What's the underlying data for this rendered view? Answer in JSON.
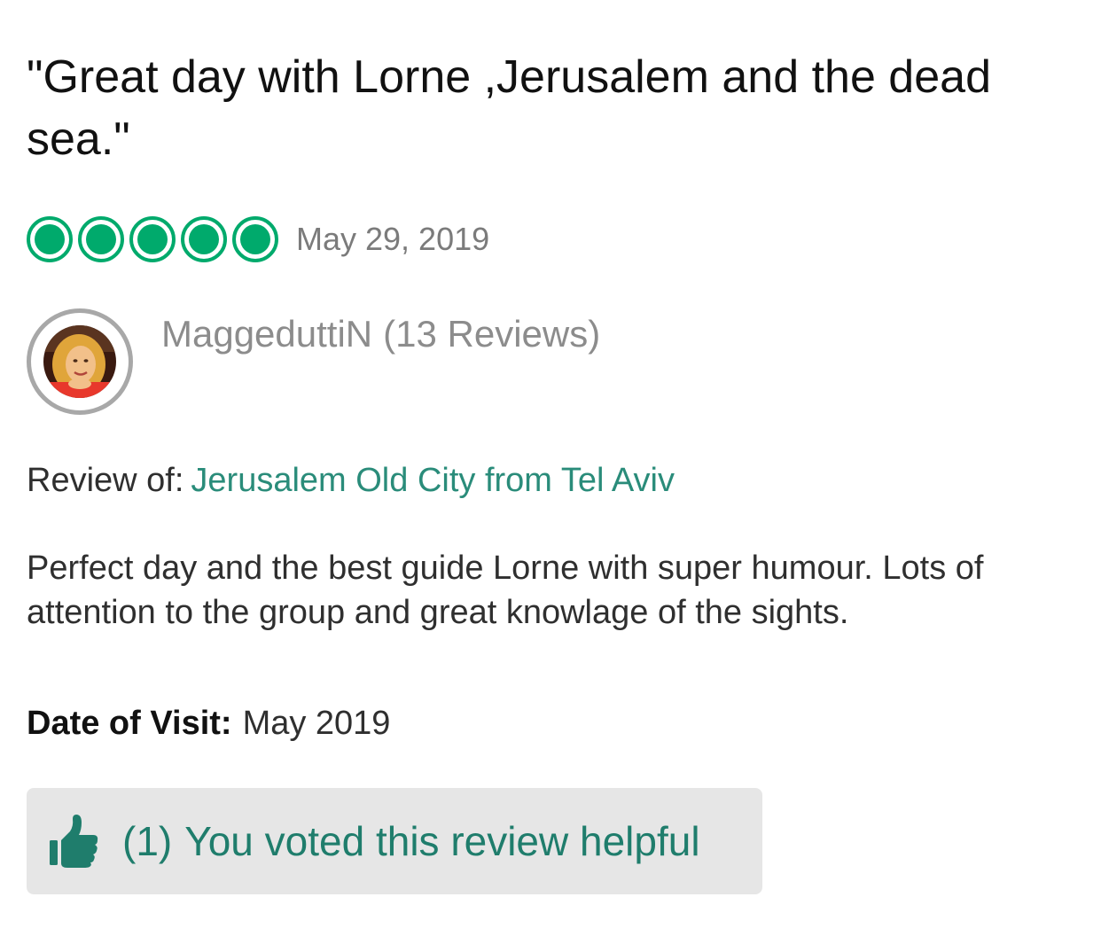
{
  "colors": {
    "accent": "#00aa6c",
    "link": "#2a8c7a",
    "helpful_text": "#1f7d6c"
  },
  "review": {
    "title": "\"Great day with Lorne ,Jerusalem and the dead sea.\"",
    "rating": 5,
    "rating_max": 5,
    "date": "May 29, 2019",
    "reviewer": {
      "name": "MaggeduttiN",
      "review_count": "(13 Reviews)"
    },
    "review_of_label": "Review of:",
    "review_of_link": "Jerusalem Old City from Tel Aviv",
    "body": "Perfect day and the best guide Lorne with super humour. Lots of attention to the group and great knowlage of the sights.",
    "date_of_visit_label": "Date of Visit:",
    "date_of_visit_value": "May 2019",
    "helpful": {
      "count": "(1)",
      "label": "You voted this review helpful",
      "icon": "thumbs-up-icon"
    }
  }
}
